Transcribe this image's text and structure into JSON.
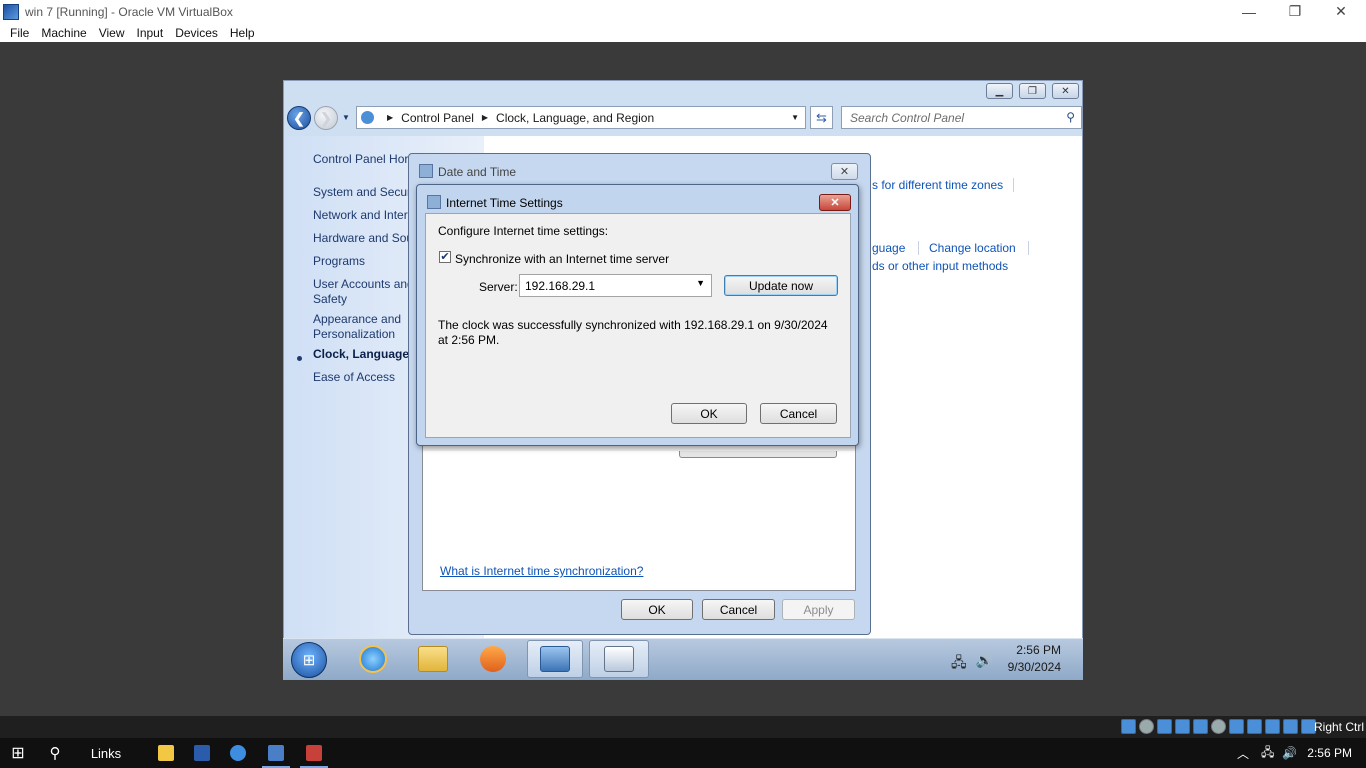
{
  "vbox": {
    "title": "win 7 [Running] - Oracle VM VirtualBox",
    "menu": [
      "File",
      "Machine",
      "View",
      "Input",
      "Devices",
      "Help"
    ],
    "host_key": "Right Ctrl",
    "controls": {
      "minimize": "—",
      "restore": "❐",
      "close": "✕"
    }
  },
  "host_taskbar": {
    "search_icon": "search-icon",
    "links_label": "Links",
    "time": "2:56 PM",
    "apps": [
      "file-explorer-icon",
      "word-icon",
      "settings-icon",
      "virtualbox-icon",
      "virtualbox-vm-icon"
    ]
  },
  "control_panel": {
    "address": {
      "root": "Control Panel",
      "current": "Clock, Language, and Region"
    },
    "search_placeholder": "Search Control Panel",
    "sidebar": [
      "Control Panel Hor",
      "System and Securi",
      "Network and Inter",
      "Hardware and Sou",
      "Programs",
      "User Accounts and",
      "Safety",
      "Appearance and",
      "Personalization",
      "Clock, Language, a",
      "Ease of Access"
    ],
    "links": {
      "timezones": "s for different time zones",
      "language": "guage",
      "change_location": "Change location",
      "keyboards": "ds or other input methods"
    }
  },
  "guest_taskbar": {
    "time": "2:56 PM",
    "date": "9/30/2024"
  },
  "date_time_dialog": {
    "title": "Date and Time",
    "link": "What is Internet time synchronization?",
    "ok": "OK",
    "cancel": "Cancel",
    "apply": "Apply"
  },
  "internet_time_dialog": {
    "title": "Internet Time Settings",
    "heading": "Configure Internet time settings:",
    "sync_label": "Synchronize with an Internet time server",
    "sync_checked": true,
    "server_label": "Server:",
    "server_value": "192.168.29.1",
    "update_button": "Update now",
    "message": "The clock was successfully synchronized with 192.168.29.1 on 9/30/2024 at 2:56 PM.",
    "ok": "OK",
    "cancel": "Cancel"
  }
}
